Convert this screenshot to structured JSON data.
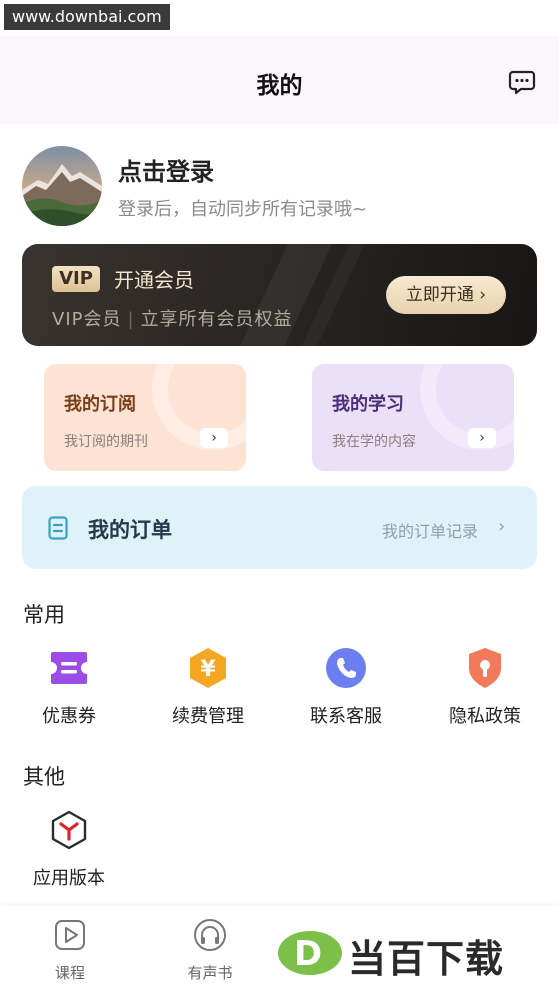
{
  "watermark": {
    "top_text": "www.downbai.com",
    "brand_text": "当百下载"
  },
  "header": {
    "title": "我的",
    "message_icon": "chat-bubble-icon"
  },
  "profile": {
    "login_title": "点击登录",
    "login_subtitle": "登录后，自动同步所有记录哦~"
  },
  "vip": {
    "badge": "VIP",
    "title": "开通会员",
    "desc_left": "VIP会员",
    "desc_sep": "|",
    "desc_right": "立享所有会员权益",
    "button_label": "立即开通 ›"
  },
  "tiles": [
    {
      "title": "我的订阅",
      "desc": "我订阅的期刊",
      "arrow": "›"
    },
    {
      "title": "我的学习",
      "desc": "我在学的内容",
      "arrow": "›"
    }
  ],
  "orders": {
    "title": "我的订单",
    "link": "我的订单记录",
    "arrow": "›"
  },
  "common": {
    "title": "常用",
    "items": [
      {
        "label": "优惠券",
        "icon": "coupon-icon",
        "color": "#9b4de6"
      },
      {
        "label": "续费管理",
        "icon": "yen-icon",
        "color": "#f5a623"
      },
      {
        "label": "联系客服",
        "icon": "phone-icon",
        "color": "#6b7ff0"
      },
      {
        "label": "隐私政策",
        "icon": "shield-lock-icon",
        "color": "#f07a5a"
      }
    ]
  },
  "other": {
    "title": "其他",
    "items": [
      {
        "label": "应用版本",
        "icon": "version-cube-icon",
        "color": "#e0202a"
      }
    ]
  },
  "bottom_nav": [
    {
      "label": "课程",
      "icon": "play-icon"
    },
    {
      "label": "有声书",
      "icon": "headphones-icon"
    }
  ]
}
